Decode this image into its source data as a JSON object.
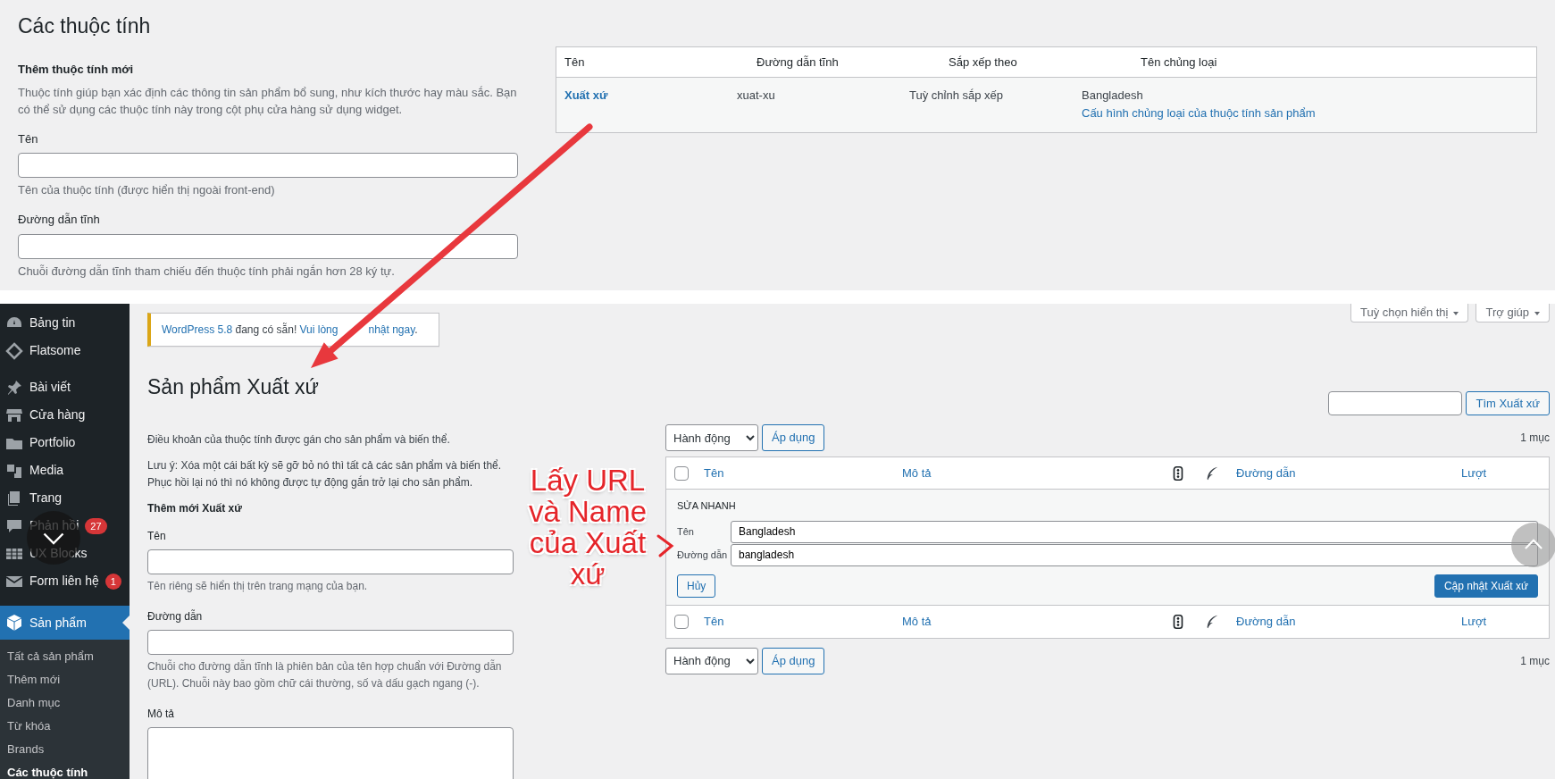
{
  "attributes_panel": {
    "title": "Các thuộc tính",
    "form": {
      "heading": "Thêm thuộc tính mới",
      "description": "Thuộc tính giúp bạn xác định các thông tin sản phẩm bổ sung, như kích thước hay màu sắc. Bạn có thể sử dụng các thuộc tính này trong cột phụ cửa hàng sử dụng widget.",
      "fields": [
        {
          "label": "Tên",
          "help": "Tên của thuộc tính (được hiển thị ngoài front-end)"
        },
        {
          "label": "Đường dẫn tĩnh",
          "help": "Chuỗi đường dẫn tĩnh tham chiếu đến thuộc tính phải ngắn hơn 28 ký tự."
        }
      ]
    },
    "table": {
      "columns": [
        "Tên",
        "Đường dẫn tĩnh",
        "Sắp xếp theo",
        "Tên chủng loại"
      ],
      "rows": [
        {
          "name": "Xuất xứ",
          "slug": "xuat-xu",
          "order_by": "Tuỳ chỉnh sắp xếp",
          "terms": "Bangladesh",
          "configure_link": "Cấu hình chủng loại của thuộc tính sản phẩm"
        }
      ]
    }
  },
  "sidebar": {
    "items": [
      {
        "label": "Bảng tin",
        "selected": false
      },
      {
        "label": "Flatsome",
        "selected": false
      },
      {
        "label": "Bài viết",
        "selected": false
      },
      {
        "label": "Cửa hàng",
        "selected": false
      },
      {
        "label": "Portfolio",
        "selected": false
      },
      {
        "label": "Media",
        "selected": false
      },
      {
        "label": "Trang",
        "selected": false
      },
      {
        "label": "Phản hồi",
        "badge": "27",
        "selected": false
      },
      {
        "label": "UX Blocks",
        "selected": false
      },
      {
        "label": "Form liên hệ",
        "badge": "1",
        "selected": false
      },
      {
        "label": "Sản phẩm",
        "selected": true,
        "children": [
          {
            "label": "Tất cả sản phẩm",
            "selected": false
          },
          {
            "label": "Thêm mới",
            "selected": false
          },
          {
            "label": "Danh mục",
            "selected": false
          },
          {
            "label": "Từ khóa",
            "selected": false
          },
          {
            "label": "Brands",
            "selected": false
          },
          {
            "label": "Các thuộc tính",
            "selected": true
          }
        ]
      }
    ]
  },
  "header_buttons": [
    "Tuỳ chọn hiển thị",
    "Trợ giúp"
  ],
  "notice": {
    "parts": [
      {
        "kind": "link",
        "text": "WordPress 5.8"
      },
      {
        "kind": "text",
        "text": " đang có sẵn! "
      },
      {
        "kind": "link",
        "text": "Vui lòng"
      },
      {
        "kind": "covered"
      },
      {
        "kind": "link",
        "text": "nhật ngay"
      },
      {
        "kind": "text",
        "text": "."
      }
    ]
  },
  "page": {
    "title": "Sản phẩm Xuất xứ"
  },
  "add_form": {
    "intro": "Điều khoản của thuộc tính được gán cho sản phẩm và biến thể.",
    "note": "Lưu ý: Xóa một cái bất kỳ sẽ gỡ bỏ nó thì tất cả các sản phẩm và biến thể. Phục hồi lại nó thì nó không được tự động gắn trở lại cho sản phẩm.",
    "heading": "Thêm mới Xuất xứ",
    "fields": [
      {
        "kind": "input",
        "label": "Tên",
        "help": "Tên riêng sẽ hiển thị trên trang mạng của bạn."
      },
      {
        "kind": "input",
        "label": "Đường dẫn",
        "help": "Chuỗi cho đường dẫn tĩnh là phiên bản của tên hợp chuẩn với Đường dẫn (URL). Chuỗi này bao gồm chữ cái thường, số và dấu gạch ngang (-)."
      },
      {
        "kind": "textarea",
        "label": "Mô tả"
      }
    ]
  },
  "search": {
    "button": "Tìm Xuất xứ"
  },
  "bulk_top": {
    "action": "Hành động",
    "apply": "Áp dụng",
    "count": "1 mục"
  },
  "terms_table": {
    "select_all_checked": false,
    "columns": [
      {
        "kind": "text",
        "label": "Tên"
      },
      {
        "kind": "text",
        "label": "Mô tả"
      },
      {
        "kind": "icon"
      },
      {
        "kind": "icon"
      },
      {
        "kind": "text",
        "label": "Đường dẫn"
      },
      {
        "kind": "text",
        "label": "Lượt"
      }
    ],
    "quick_edit": {
      "heading": "SỬA NHANH",
      "fields": [
        {
          "label": "Tên",
          "value": "Bangladesh"
        },
        {
          "label": "Đường dẫn",
          "value": "bangladesh"
        }
      ],
      "cancel": "Hủy",
      "submit": "Cập nhật Xuất xứ"
    },
    "footer_columns": [
      {
        "kind": "text",
        "label": "Tên"
      },
      {
        "kind": "text",
        "label": "Mô tả"
      },
      {
        "kind": "icon"
      },
      {
        "kind": "icon"
      },
      {
        "kind": "text",
        "label": "Đường dẫn"
      },
      {
        "kind": "text",
        "label": "Lượt"
      }
    ]
  },
  "bulk_bottom": {
    "action": "Hành động",
    "apply": "Áp dụng",
    "count": "1 mục"
  },
  "annotation": {
    "text": "Lấy URL và Name của Xuất xứ"
  }
}
